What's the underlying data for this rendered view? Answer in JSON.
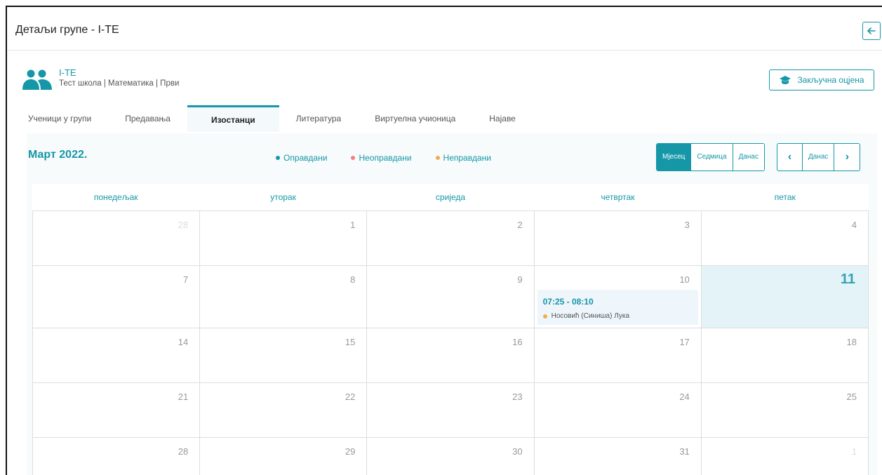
{
  "header": {
    "title": "Детаљи групе - I-TE",
    "back_icon": "arrow-left-icon"
  },
  "group": {
    "name": "I-TE",
    "subtitle": "Тест школа | Математика | Први",
    "icon": "users-icon"
  },
  "final_grade_button": {
    "label": "Закључна оцјена",
    "icon": "graduation-cap-icon"
  },
  "tabs": [
    {
      "label": "Ученици у групи",
      "active": false
    },
    {
      "label": "Предавања",
      "active": false
    },
    {
      "label": "Изостанци",
      "active": true
    },
    {
      "label": "Литература",
      "active": false
    },
    {
      "label": "Виртуелна учионица",
      "active": false
    },
    {
      "label": "Најаве",
      "active": false
    }
  ],
  "calendar": {
    "title": "Март 2022.",
    "legend": [
      {
        "label": "Оправдани",
        "color": "#1597a8"
      },
      {
        "label": "Неоправдани",
        "color": "#f08080"
      },
      {
        "label": "Неправдани",
        "color": "#f0ad4e"
      }
    ],
    "views": [
      {
        "label": "Мјесец",
        "active": true
      },
      {
        "label": "Седмица",
        "active": false
      },
      {
        "label": "Данас",
        "active": false
      }
    ],
    "nav": {
      "prev": "‹",
      "today": "Данас",
      "next": "›"
    },
    "weekdays": [
      "понедељак",
      "уторак",
      "сриједа",
      "четвртак",
      "петак"
    ],
    "weeks": [
      [
        "28",
        "1",
        "2",
        "3",
        "4"
      ],
      [
        "7",
        "8",
        "9",
        "10",
        "11"
      ],
      [
        "14",
        "15",
        "16",
        "17",
        "18"
      ],
      [
        "21",
        "22",
        "23",
        "24",
        "25"
      ],
      [
        "28",
        "29",
        "30",
        "31",
        "1"
      ]
    ],
    "event": {
      "time": "07:25 - 08:10",
      "person": "Носовић (Синиша) Лука",
      "color": "#f0ad4e"
    },
    "accent": "#1597a8"
  }
}
